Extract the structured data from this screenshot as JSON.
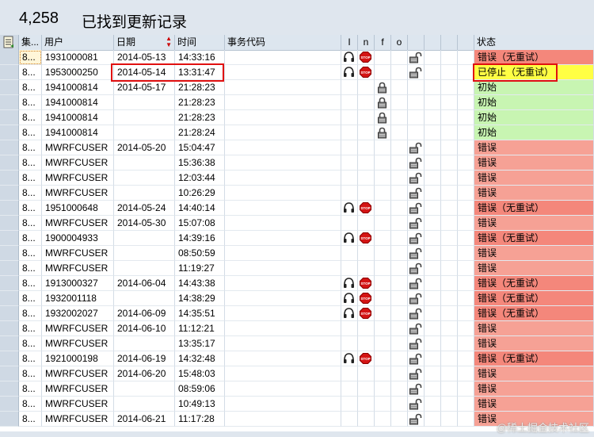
{
  "header": {
    "count": "4,258",
    "title": "已找到更新记录"
  },
  "columns": {
    "set": "集...",
    "user": "用户",
    "date": "日期",
    "time": "时间",
    "tcode": "事务代码",
    "i": "I",
    "n": "n",
    "f": "f",
    "o": "o",
    "status": "状态"
  },
  "rows": [
    {
      "set": "8...",
      "user": "1931000081",
      "date": "2014-05-13",
      "time": "14:33:16",
      "icons": [
        "headset",
        "stop",
        "lock-open"
      ],
      "status": "错误（无重试）",
      "status_type": "red"
    },
    {
      "set": "8...",
      "user": "1953000250",
      "date": "2014-05-14",
      "time": "13:31:47",
      "icons": [
        "headset",
        "stop",
        "lock-open"
      ],
      "status": "已停止（无重试）",
      "status_type": "yellow"
    },
    {
      "set": "8...",
      "user": "1941000814",
      "date": "2014-05-17",
      "time": "21:28:23",
      "icons": [
        "lock"
      ],
      "status": "初始",
      "status_type": "green"
    },
    {
      "set": "8...",
      "user": "1941000814",
      "date": "",
      "time": "21:28:23",
      "icons": [
        "lock"
      ],
      "status": "初始",
      "status_type": "green"
    },
    {
      "set": "8...",
      "user": "1941000814",
      "date": "",
      "time": "21:28:23",
      "icons": [
        "lock"
      ],
      "status": "初始",
      "status_type": "green"
    },
    {
      "set": "8...",
      "user": "1941000814",
      "date": "",
      "time": "21:28:24",
      "icons": [
        "lock"
      ],
      "status": "初始",
      "status_type": "green"
    },
    {
      "set": "8...",
      "user": "MWRFCUSER",
      "date": "2014-05-20",
      "time": "15:04:47",
      "icons": [
        "lock-open"
      ],
      "status": "错误",
      "status_type": "redl"
    },
    {
      "set": "8...",
      "user": "MWRFCUSER",
      "date": "",
      "time": "15:36:38",
      "icons": [
        "lock-open"
      ],
      "status": "错误",
      "status_type": "redl"
    },
    {
      "set": "8...",
      "user": "MWRFCUSER",
      "date": "",
      "time": "12:03:44",
      "icons": [
        "lock-open"
      ],
      "status": "错误",
      "status_type": "redl"
    },
    {
      "set": "8...",
      "user": "MWRFCUSER",
      "date": "",
      "time": "10:26:29",
      "icons": [
        "lock-open"
      ],
      "status": "错误",
      "status_type": "redl"
    },
    {
      "set": "8...",
      "user": "1951000648",
      "date": "2014-05-24",
      "time": "14:40:14",
      "icons": [
        "headset",
        "stop",
        "lock-open"
      ],
      "status": "错误（无重试）",
      "status_type": "red"
    },
    {
      "set": "8...",
      "user": "MWRFCUSER",
      "date": "2014-05-30",
      "time": "15:07:08",
      "icons": [
        "lock-open"
      ],
      "status": "错误",
      "status_type": "redl"
    },
    {
      "set": "8...",
      "user": "1900004933",
      "date": "",
      "time": "14:39:16",
      "icons": [
        "headset",
        "stop",
        "lock-open"
      ],
      "status": "错误（无重试）",
      "status_type": "red"
    },
    {
      "set": "8...",
      "user": "MWRFCUSER",
      "date": "",
      "time": "08:50:59",
      "icons": [
        "lock-open"
      ],
      "status": "错误",
      "status_type": "redl"
    },
    {
      "set": "8...",
      "user": "MWRFCUSER",
      "date": "",
      "time": "11:19:27",
      "icons": [
        "lock-open"
      ],
      "status": "错误",
      "status_type": "redl"
    },
    {
      "set": "8...",
      "user": "1913000327",
      "date": "2014-06-04",
      "time": "14:43:38",
      "icons": [
        "headset",
        "stop",
        "lock-open"
      ],
      "status": "错误（无重试）",
      "status_type": "red"
    },
    {
      "set": "8...",
      "user": "1932001118",
      "date": "",
      "time": "14:38:29",
      "icons": [
        "headset",
        "stop",
        "lock-open"
      ],
      "status": "错误（无重试）",
      "status_type": "red"
    },
    {
      "set": "8...",
      "user": "1932002027",
      "date": "2014-06-09",
      "time": "14:35:51",
      "icons": [
        "headset",
        "stop",
        "lock-open"
      ],
      "status": "错误（无重试）",
      "status_type": "red"
    },
    {
      "set": "8...",
      "user": "MWRFCUSER",
      "date": "2014-06-10",
      "time": "11:12:21",
      "icons": [
        "lock-open"
      ],
      "status": "错误",
      "status_type": "redl"
    },
    {
      "set": "8...",
      "user": "MWRFCUSER",
      "date": "",
      "time": "13:35:17",
      "icons": [
        "lock-open"
      ],
      "status": "错误",
      "status_type": "redl"
    },
    {
      "set": "8...",
      "user": "1921000198",
      "date": "2014-06-19",
      "time": "14:32:48",
      "icons": [
        "headset",
        "stop",
        "lock-open"
      ],
      "status": "错误（无重试）",
      "status_type": "red"
    },
    {
      "set": "8...",
      "user": "MWRFCUSER",
      "date": "2014-06-20",
      "time": "15:48:03",
      "icons": [
        "lock-open"
      ],
      "status": "错误",
      "status_type": "redl"
    },
    {
      "set": "8...",
      "user": "MWRFCUSER",
      "date": "",
      "time": "08:59:06",
      "icons": [
        "lock-open"
      ],
      "status": "错误",
      "status_type": "redl"
    },
    {
      "set": "8...",
      "user": "MWRFCUSER",
      "date": "",
      "time": "10:49:13",
      "icons": [
        "lock-open"
      ],
      "status": "错误",
      "status_type": "redl"
    },
    {
      "set": "8...",
      "user": "MWRFCUSER",
      "date": "2014-06-21",
      "time": "11:17:28",
      "icons": [
        "lock-open"
      ],
      "status": "错误",
      "status_type": "redl"
    }
  ],
  "watermark": "@稀土掘金技术社区"
}
